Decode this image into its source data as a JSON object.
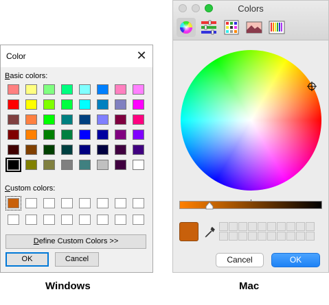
{
  "windows": {
    "title": "Color",
    "basic_label_accel": "B",
    "basic_label_rest": "asic colors:",
    "basic_colors": [
      [
        "#ff8080",
        "#ffff80",
        "#80ff80",
        "#00ff80",
        "#80ffff",
        "#0080ff",
        "#ff80c0",
        "#ff80ff"
      ],
      [
        "#ff0000",
        "#ffff00",
        "#80ff00",
        "#00ff40",
        "#00ffff",
        "#0080c0",
        "#8080c0",
        "#ff00ff"
      ],
      [
        "#804040",
        "#ff8040",
        "#00ff00",
        "#008080",
        "#004080",
        "#8080ff",
        "#800040",
        "#ff0080"
      ],
      [
        "#800000",
        "#ff8000",
        "#008000",
        "#008040",
        "#0000ff",
        "#0000a0",
        "#800080",
        "#8000ff"
      ],
      [
        "#400000",
        "#804000",
        "#004000",
        "#004040",
        "#000080",
        "#000040",
        "#400040",
        "#400080"
      ],
      [
        "#000000",
        "#808000",
        "#808040",
        "#808080",
        "#408080",
        "#c0c0c0",
        "#400040",
        "#ffffff"
      ]
    ],
    "custom_label_accel": "C",
    "custom_label_rest": "ustom colors:",
    "custom_colors": [
      [
        "#c8600b",
        "#ffffff",
        "#ffffff",
        "#ffffff",
        "#ffffff",
        "#ffffff",
        "#ffffff",
        "#ffffff"
      ],
      [
        "#ffffff",
        "#ffffff",
        "#ffffff",
        "#ffffff",
        "#ffffff",
        "#ffffff",
        "#ffffff",
        "#ffffff"
      ]
    ],
    "define_accel": "D",
    "define_rest": "efine Custom Colors >>",
    "ok_label": "OK",
    "cancel_label": "Cancel",
    "caption": "Windows"
  },
  "mac": {
    "title": "Colors",
    "toolbar": [
      "color-wheel-icon",
      "color-sliders-icon",
      "color-palettes-icon",
      "image-palettes-icon",
      "pencils-icon"
    ],
    "current_color": "#c8600b",
    "cancel_label": "Cancel",
    "ok_label": "OK",
    "caption": "Mac"
  }
}
